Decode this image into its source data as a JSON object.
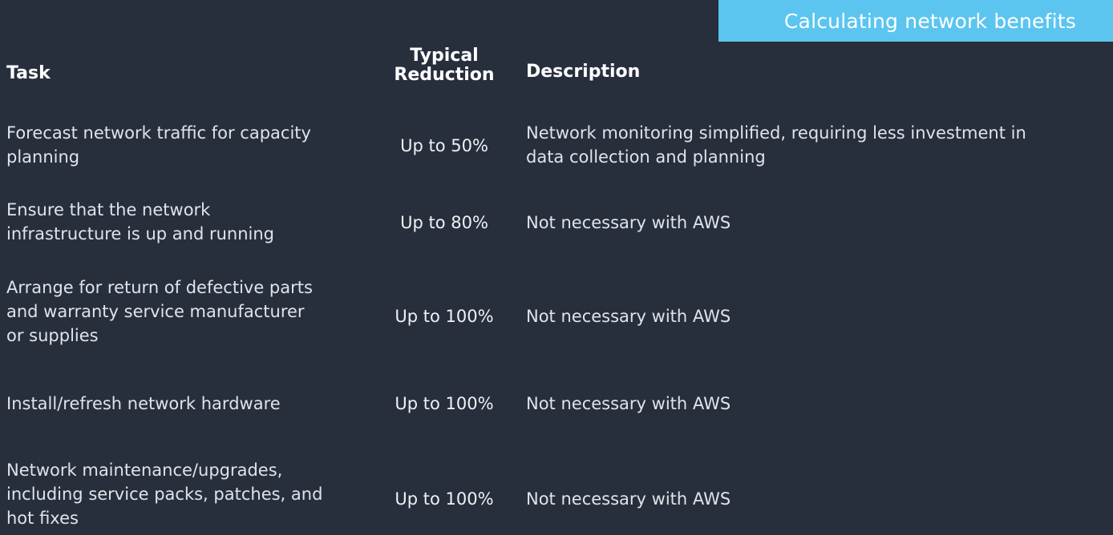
{
  "slide": {
    "background_color": "#272f3d",
    "accent_color": "#5bc5f0",
    "text_color": "#dfe4ea"
  },
  "banner": {
    "title": "Calculating network benefits"
  },
  "table": {
    "headers": {
      "task": "Task",
      "reduction": "Typical\nReduction",
      "description": "Description"
    },
    "rows": [
      {
        "task": "Forecast network traffic for capacity\nplanning",
        "reduction": "Up to 50%",
        "description": "Network monitoring simplified, requiring less investment in\ndata collection and planning"
      },
      {
        "task": "Ensure that the network\ninfrastructure is up and running",
        "reduction": "Up to 80%",
        "description": "Not necessary with AWS"
      },
      {
        "task": "Arrange for return of defective parts\nand warranty service manufacturer\nor supplies",
        "reduction": "Up to 100%",
        "description": "Not necessary with AWS"
      },
      {
        "task": "Install/refresh network hardware",
        "reduction": "Up to 100%",
        "description": "Not necessary with AWS"
      },
      {
        "task": "Network maintenance/upgrades,\nincluding service packs, patches, and\nhot fixes",
        "reduction": "Up to 100%",
        "description": "Not necessary with AWS"
      }
    ]
  }
}
